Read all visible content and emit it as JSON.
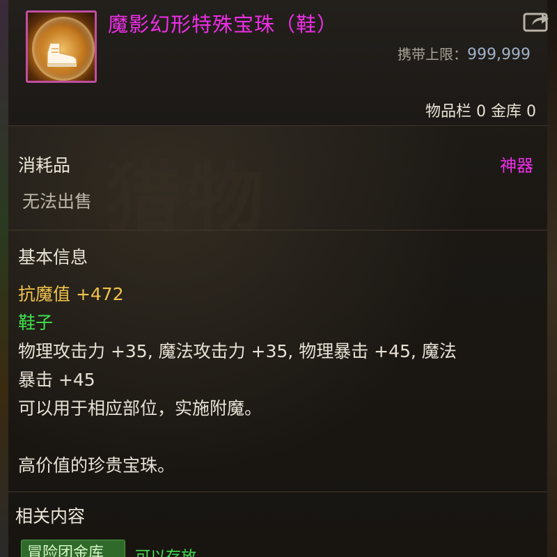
{
  "item": {
    "title": "魔影幻形特殊宝珠（鞋）",
    "icon": "shoe-orb-icon",
    "carry_limit_label": "携带上限：",
    "carry_limit_value": "999,999",
    "inventory_count": "物品栏 0 金库 0",
    "type": "消耗品",
    "rarity": "神器",
    "sell_status": "无法出售"
  },
  "basic_info": {
    "title": "基本信息",
    "magic_resist": "抗魔值 +472",
    "slot": "鞋子",
    "stats_line1": "物理攻击力 +35, 魔法攻击力 +35, 物理暴击 +45, 魔法",
    "stats_line2": "暴击 +45",
    "usage": "可以用于相应部位，实施附魔。",
    "flavor": "高价值的珍贵宝珠。"
  },
  "related": {
    "title": "相关内容",
    "badge": "冒险团金库",
    "status": "可以存放"
  },
  "colors": {
    "title": "#ee2ee6",
    "rarity": "#ee2ee6",
    "resist": "#f2c34c",
    "slot": "#3fe24f",
    "icon_border": "#c24ea0"
  },
  "watermark": "猎物"
}
